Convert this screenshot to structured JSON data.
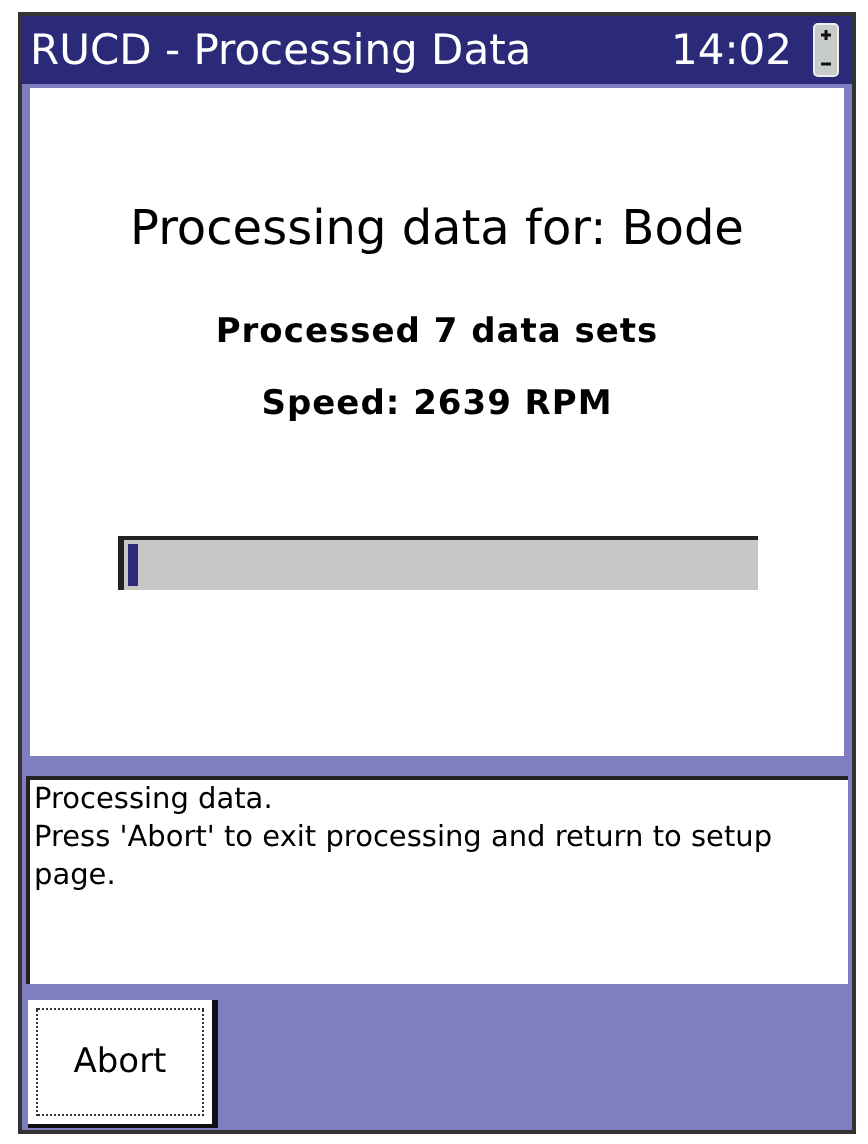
{
  "window": {
    "title": "RUCD - Processing Data",
    "time": "14:02"
  },
  "heading": "Processing data for: Bode",
  "status_lines": [
    "Processed 7 data sets",
    "Speed: 2639 RPM"
  ],
  "progress": {
    "level": 0.03
  },
  "message": {
    "lines": [
      "Processing data.",
      "Press 'Abort' to exit processing and return to setup page."
    ]
  },
  "buttons": [
    {
      "label": "Abort",
      "focused": true
    }
  ]
}
